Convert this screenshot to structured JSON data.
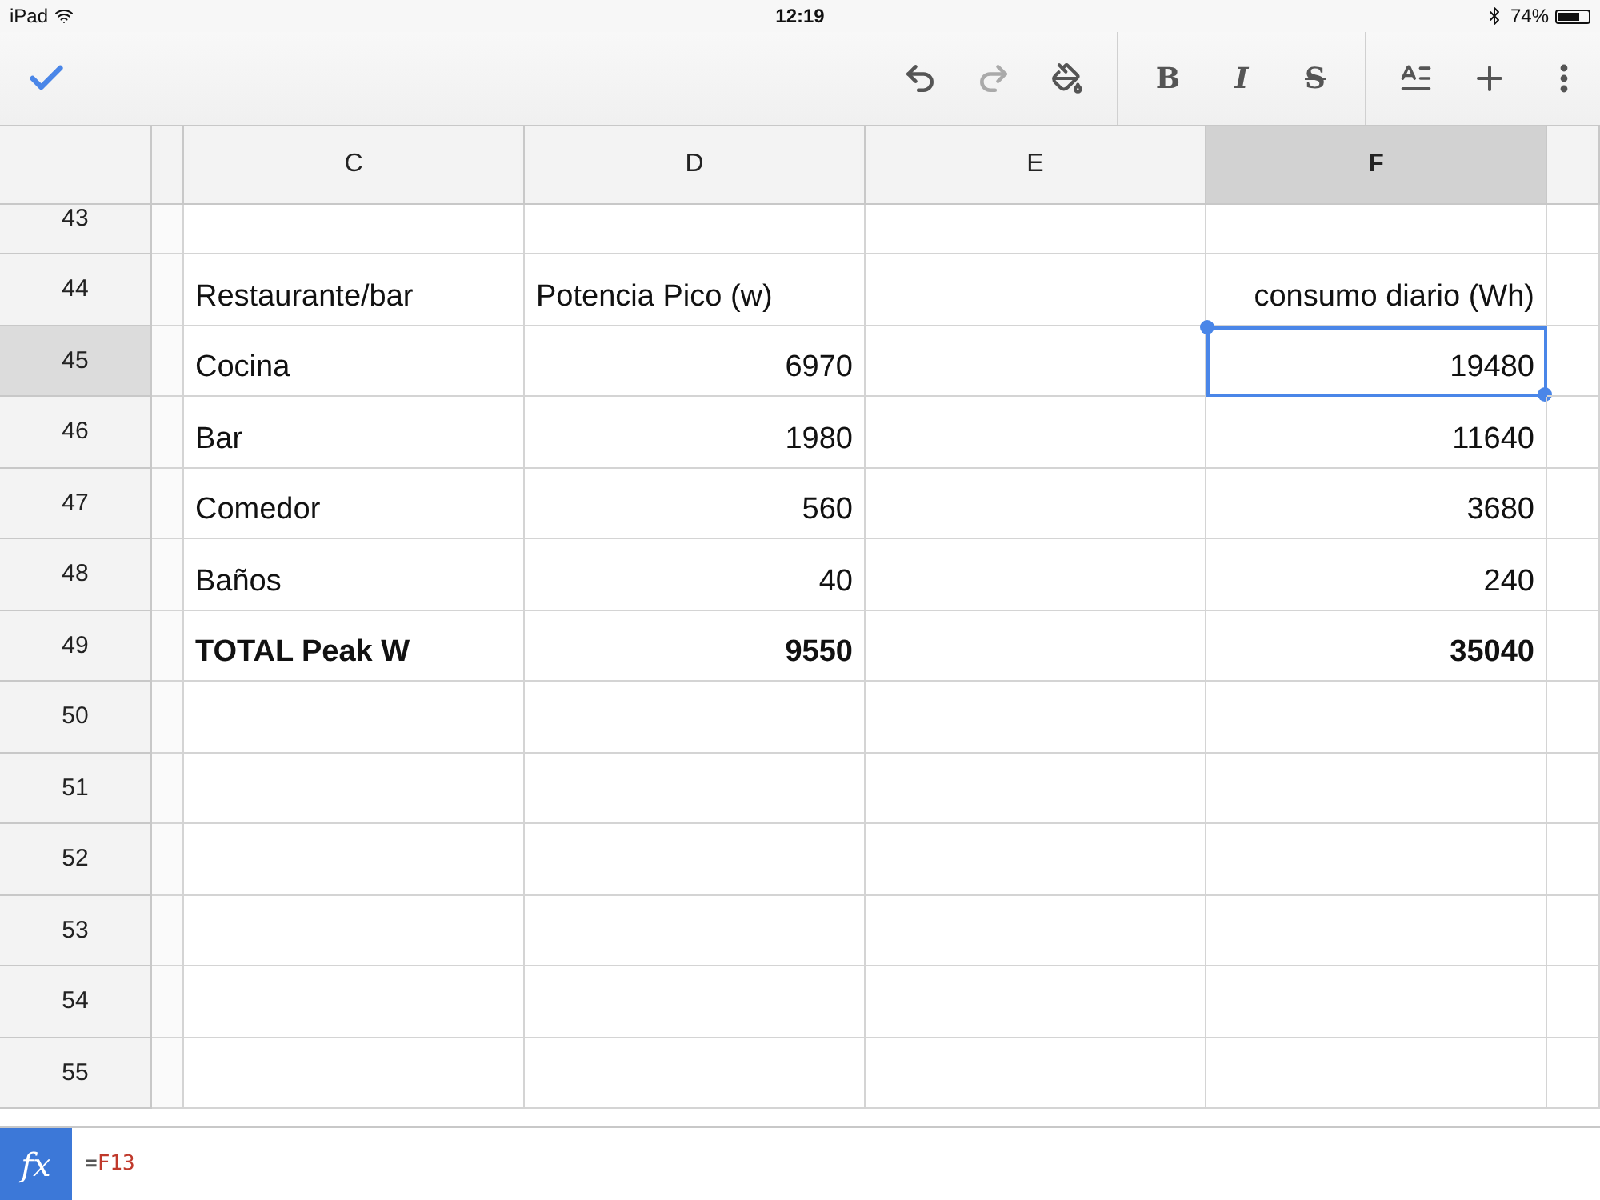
{
  "status_bar": {
    "device": "iPad",
    "time": "12:19",
    "battery": "74%"
  },
  "toolbar": {
    "undo": {
      "disabled": false
    },
    "redo": {
      "disabled": true
    },
    "format_buttons": [
      {
        "kind": "bold",
        "label": "B"
      },
      {
        "kind": "italic",
        "label": "I"
      },
      {
        "kind": "strike",
        "label": "S"
      }
    ]
  },
  "columns": [
    {
      "label": "C",
      "selected": false
    },
    {
      "label": "D",
      "selected": false
    },
    {
      "label": "E",
      "selected": false
    },
    {
      "label": "F",
      "selected": true
    }
  ],
  "rows": [
    {
      "number": "43",
      "selected": false,
      "cells": [
        {},
        {},
        {},
        {}
      ]
    },
    {
      "number": "44",
      "selected": false,
      "cells": [
        {
          "text": "Restaurante/bar",
          "numeric": false,
          "bold": false
        },
        {
          "text": "Potencia Pico (w)",
          "numeric": false,
          "bold": false
        },
        {},
        {
          "text": "consumo diario (Wh)",
          "numeric": true,
          "bold": false
        }
      ]
    },
    {
      "number": "45",
      "selected": true,
      "cells": [
        {
          "text": "Cocina",
          "numeric": false,
          "bold": false
        },
        {
          "text": "6970",
          "numeric": true,
          "bold": false
        },
        {},
        {
          "text": "19480",
          "numeric": true,
          "bold": false,
          "selected": true
        }
      ]
    },
    {
      "number": "46",
      "selected": false,
      "cells": [
        {
          "text": "Bar",
          "numeric": false,
          "bold": false
        },
        {
          "text": "1980",
          "numeric": true,
          "bold": false
        },
        {},
        {
          "text": "11640",
          "numeric": true,
          "bold": false
        }
      ]
    },
    {
      "number": "47",
      "selected": false,
      "cells": [
        {
          "text": "Comedor",
          "numeric": false,
          "bold": false
        },
        {
          "text": "560",
          "numeric": true,
          "bold": false
        },
        {},
        {
          "text": "3680",
          "numeric": true,
          "bold": false
        }
      ]
    },
    {
      "number": "48",
      "selected": false,
      "cells": [
        {
          "text": "Baños",
          "numeric": false,
          "bold": false
        },
        {
          "text": "40",
          "numeric": true,
          "bold": false
        },
        {},
        {
          "text": "240",
          "numeric": true,
          "bold": false
        }
      ]
    },
    {
      "number": "49",
      "selected": false,
      "cells": [
        {
          "text": "TOTAL Peak W",
          "numeric": false,
          "bold": true
        },
        {
          "text": "9550",
          "numeric": true,
          "bold": true
        },
        {},
        {
          "text": "35040",
          "numeric": true,
          "bold": true
        }
      ]
    },
    {
      "number": "50",
      "selected": false,
      "cells": [
        {},
        {},
        {},
        {}
      ]
    },
    {
      "number": "51",
      "selected": false,
      "cells": [
        {},
        {},
        {},
        {}
      ]
    },
    {
      "number": "52",
      "selected": false,
      "cells": [
        {},
        {},
        {},
        {}
      ]
    },
    {
      "number": "53",
      "selected": false,
      "cells": [
        {},
        {},
        {},
        {}
      ]
    },
    {
      "number": "54",
      "selected": false,
      "cells": [
        {},
        {},
        {},
        {}
      ]
    },
    {
      "number": "55",
      "selected": false,
      "cells": [
        {},
        {},
        {},
        {}
      ]
    }
  ],
  "formula_bar": {
    "label": "fx",
    "operator": "=",
    "reference": "F13"
  }
}
